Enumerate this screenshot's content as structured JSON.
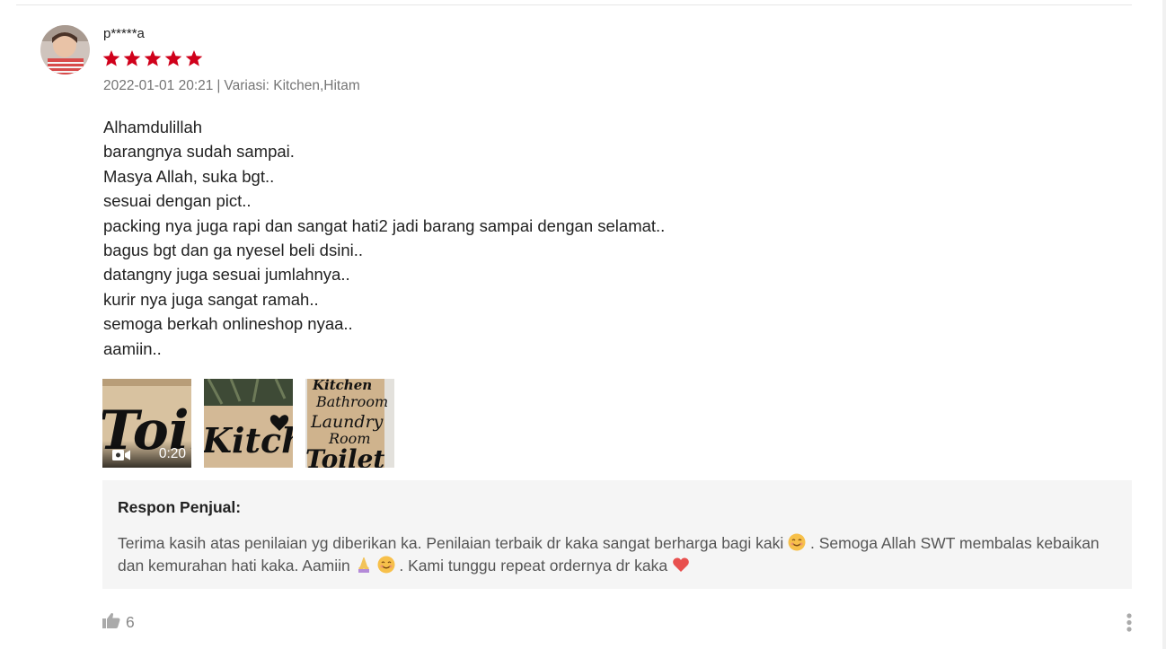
{
  "review": {
    "username": "p*****a",
    "rating": 5,
    "date": "2022-01-01 20:21",
    "separator": "|",
    "variation": "Variasi: Kitchen,Hitam",
    "comment_lines": [
      "Alhamdulillah",
      "barangnya sudah sampai.",
      "Masya Allah, suka bgt..",
      "sesuai dengan pict..",
      "packing nya juga rapi dan sangat hati2 jadi barang sampai dengan selamat..",
      "bagus bgt dan ga nyesel beli dsini..",
      "datangny juga sesuai jumlahnya..",
      "kurir nya juga sangat ramah..",
      "semoga berkah onlineshop nyaa..",
      "aamiin.."
    ],
    "media": {
      "video_duration": "0:20"
    },
    "seller_response": {
      "title": "Respon Penjual:",
      "text_part1": "Terima kasih atas penilaian yg diberikan ka. Penilaian terbaik dr kaka sangat berharga bagi kaki",
      "text_part2": ". Semoga Allah SWT membalas kebaikan dan kemurahan hati kaka. Aamiin",
      "text_part3": ". Kami tunggu repeat ordernya dr kaka"
    },
    "likes": "6"
  },
  "colors": {
    "star": "#d0011b",
    "meta_text": "#757575",
    "seller_bg": "#f5f5f5",
    "like_icon": "#aaaaaa"
  },
  "icons": {
    "star": "star-icon",
    "video": "video-camera-icon",
    "like": "thumbs-up-icon",
    "more": "more-vertical-icon"
  }
}
